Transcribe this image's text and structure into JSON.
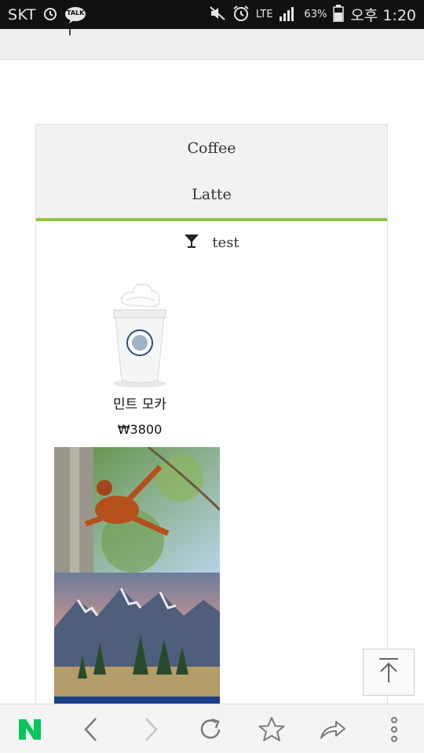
{
  "status_bar": {
    "carrier": "SKT",
    "talk_label": "TALK",
    "network": "LTE",
    "battery": "63%",
    "time": "오후 1:20"
  },
  "menu": {
    "tabs": [
      {
        "label": "Coffee"
      },
      {
        "label": "Latte"
      }
    ],
    "filter_label": "test"
  },
  "product": {
    "name": "민트 모카",
    "price": "₩3800"
  },
  "colors": {
    "accent": "#8cc63f",
    "naver_green": "#03c75a"
  },
  "bottom_bar": {
    "icons": [
      "naver-logo-icon",
      "back-icon",
      "forward-icon",
      "refresh-icon",
      "star-icon",
      "share-icon",
      "more-icon"
    ]
  }
}
